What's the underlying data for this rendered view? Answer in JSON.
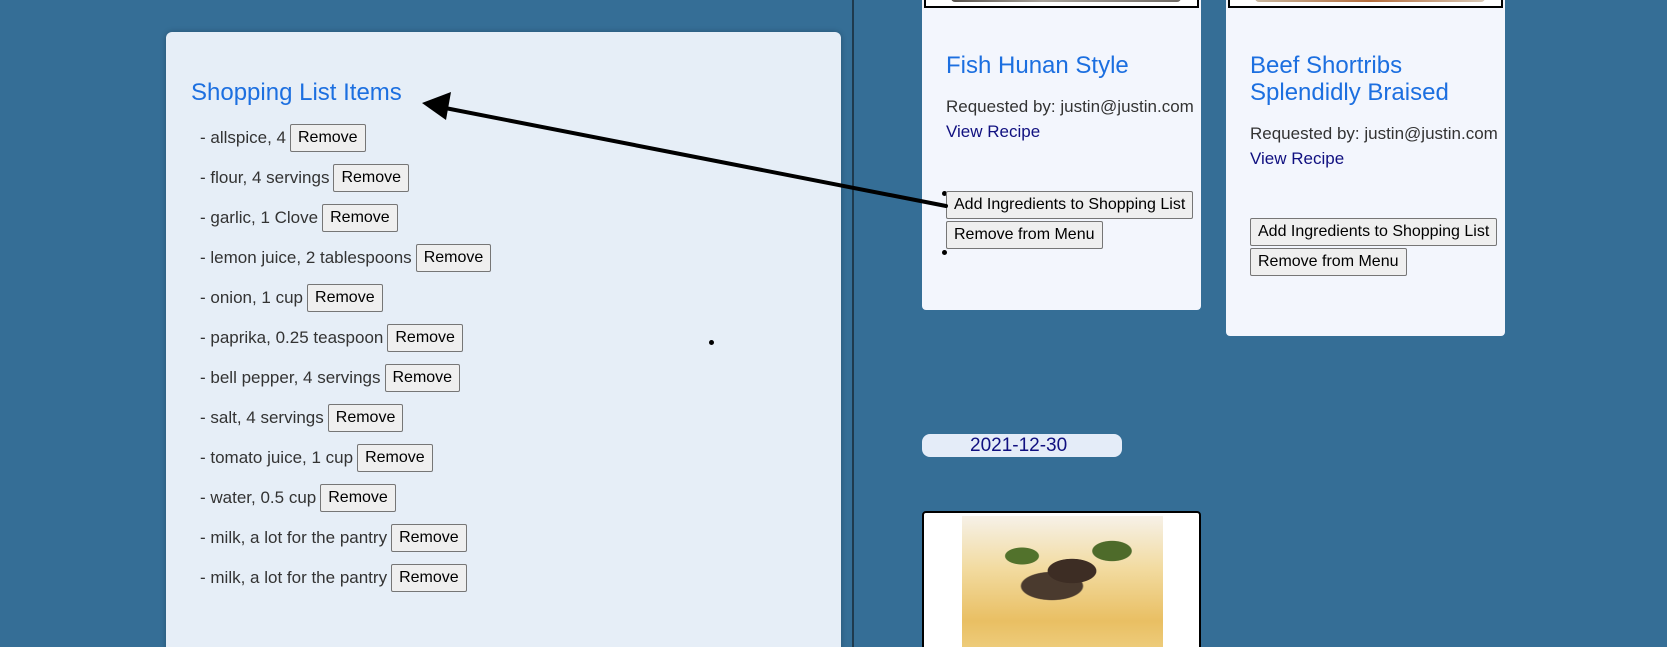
{
  "shopping_list": {
    "title": "Shopping List Items",
    "remove_label": "Remove",
    "items": [
      "- allspice, 4",
      "- flour, 4 servings",
      "- garlic, 1 Clove",
      "- lemon juice, 2 tablespoons",
      "- onion, 1 cup",
      "- paprika, 0.25 teaspoon",
      "- bell pepper, 4 servings",
      "- salt, 4 servings",
      "- tomato juice, 1 cup",
      "- water, 0.5 cup",
      "- milk, a lot for the pantry",
      "- milk, a lot for the pantry"
    ]
  },
  "menu": {
    "recipes": [
      {
        "title": "Fish Hunan Style",
        "requested_by": "Requested by: justin@justin.com",
        "view_link": "View Recipe",
        "add_button": "Add Ingredients to Shopping List",
        "remove_button": "Remove from Menu"
      },
      {
        "title": "Beef Shortribs Splendidly Braised",
        "requested_by": "Requested by: justin@justin.com",
        "view_link": "View Recipe",
        "add_button": "Add Ingredients to Shopping List",
        "remove_button": "Remove from Menu"
      }
    ],
    "next_date": "2021-12-30"
  },
  "colors": {
    "background": "#356e96",
    "heading": "#1c6fe0",
    "link": "#101080",
    "panel": "#e6eef7",
    "card": "#f3f6fd"
  }
}
